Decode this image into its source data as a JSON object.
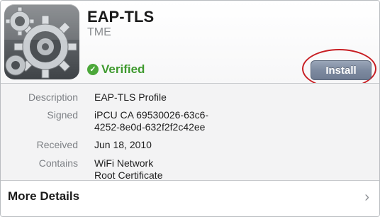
{
  "profile": {
    "title": "EAP-TLS",
    "subtitle": "TME",
    "verified_label": "Verified",
    "install_label": "Install"
  },
  "details": [
    {
      "label": "Description",
      "lines": [
        "EAP-TLS Profile"
      ]
    },
    {
      "label": "Signed",
      "lines": [
        "iPCU CA 69530026-63c6-",
        "4252-8e0d-632f2f2c42ee"
      ]
    },
    {
      "label": "Received",
      "lines": [
        "Jun 18, 2010"
      ]
    },
    {
      "label": "Contains",
      "lines": [
        "WiFi Network",
        "Root Certificate"
      ]
    }
  ],
  "more_details_label": "More Details",
  "icons": {
    "profile": "settings-gears-icon",
    "verified": "checkmark-circle-icon",
    "more": "chevron-right-icon"
  },
  "colors": {
    "verified": "#3f9a2f",
    "install_button": "#7d8aa0",
    "highlight_ring": "#c81e23"
  }
}
